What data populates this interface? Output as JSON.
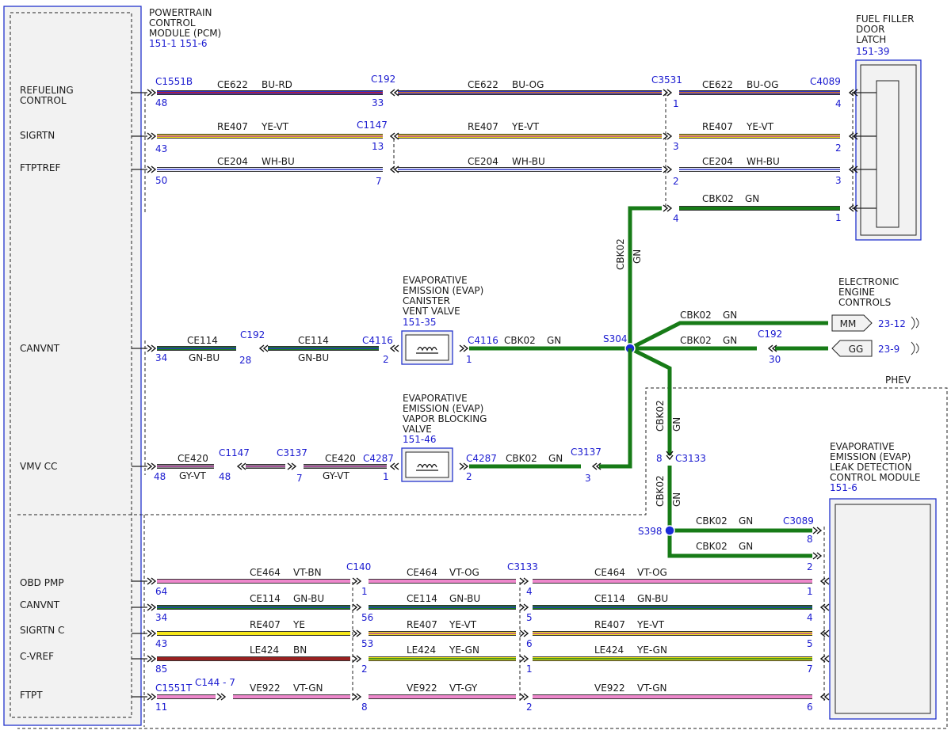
{
  "pcm": {
    "name": [
      "POWERTRAIN",
      "CONTROL",
      "MODULE (PCM)"
    ],
    "ref": "151-1 151-6",
    "pins": [
      "REFUELING",
      "CONTROL",
      "SIGRTN",
      "FTPTREF",
      "CANVNT",
      "VMV CC",
      "OBD PMP",
      "CANVNT",
      "SIGRTN C",
      "C-VREF",
      "FTPT"
    ]
  },
  "latch": {
    "name": [
      "FUEL FILLER",
      "DOOR",
      "LATCH"
    ],
    "ref": "151-39"
  },
  "eec": {
    "name": [
      "ELECTRONIC",
      "ENGINE",
      "CONTROLS"
    ],
    "mm": "MM",
    "gg": "GG",
    "mm_ref": "23-12",
    "gg_ref": "23-9"
  },
  "vent": {
    "name": [
      "EVAPORATIVE",
      "EMISSION (EVAP)",
      "CANISTER",
      "VENT VALVE"
    ],
    "ref": "151-35"
  },
  "vbv": {
    "name": [
      "EVAPORATIVE",
      "EMISSION (EVAP)",
      "VAPOR BLOCKING",
      "VALVE"
    ],
    "ref": "151-46"
  },
  "ldcm": {
    "name": [
      "EVAPORATIVE",
      "EMISSION (EVAP)",
      "LEAK DETECTION",
      "CONTROL MODULE"
    ],
    "ref": "151-6"
  },
  "phev": "PHEV",
  "splices": [
    "S304",
    "S398"
  ],
  "connectors": [
    "C1551B",
    "C192",
    "C3531",
    "C4089",
    "C1147",
    "C192",
    "C4116",
    "C4116",
    "C192",
    "C1147",
    "C3137",
    "C4287",
    "C4287",
    "C3137",
    "C3133",
    "C3089",
    "C140",
    "C3133",
    "C1551T",
    "C144 - 7"
  ],
  "pins": [
    "48",
    "33",
    "1",
    "4",
    "43",
    "13",
    "3",
    "2",
    "50",
    "7",
    "2",
    "3",
    "4",
    "1",
    "34",
    "28",
    "2",
    "1",
    "30",
    "48",
    "48",
    "7",
    "1",
    "2",
    "3",
    "8",
    "8",
    "2",
    "64",
    "1",
    "4",
    "1",
    "34",
    "56",
    "5",
    "4",
    "43",
    "53",
    "6",
    "5",
    "85",
    "2",
    "1",
    "7",
    "11",
    "8",
    "2",
    "6"
  ],
  "wires": [
    [
      "CE622",
      "BU-RD"
    ],
    [
      "CE622",
      "BU-OG"
    ],
    [
      "CE622",
      "BU-OG"
    ],
    [
      "RE407",
      "YE-VT"
    ],
    [
      "RE407",
      "YE-VT"
    ],
    [
      "RE407",
      "YE-VT"
    ],
    [
      "CE204",
      "WH-BU"
    ],
    [
      "CE204",
      "WH-BU"
    ],
    [
      "CE204",
      "WH-BU"
    ],
    [
      "CBK02",
      "GN"
    ],
    [
      "CE114",
      "GN-BU"
    ],
    [
      "CE114",
      "GN-BU"
    ],
    [
      "CBK02",
      "GN"
    ],
    [
      "CBK02",
      "GN"
    ],
    [
      "CBK02",
      "GN"
    ],
    [
      "CE420",
      "GY-VT"
    ],
    [
      "CE420",
      "GY-VT"
    ],
    [
      "CBK02",
      "GN"
    ],
    [
      "CBK02",
      "GN"
    ],
    [
      "CBK02",
      "GN"
    ],
    [
      "CE464",
      "VT-BN"
    ],
    [
      "CE464",
      "VT-OG"
    ],
    [
      "CE464",
      "VT-OG"
    ],
    [
      "CE114",
      "GN-BU"
    ],
    [
      "CE114",
      "GN-BU"
    ],
    [
      "CE114",
      "GN-BU"
    ],
    [
      "RE407",
      "YE"
    ],
    [
      "RE407",
      "YE-VT"
    ],
    [
      "RE407",
      "YE-VT"
    ],
    [
      "LE424",
      "BN"
    ],
    [
      "LE424",
      "YE-GN"
    ],
    [
      "LE424",
      "YE-GN"
    ],
    [
      "VE922",
      "VT-GN"
    ],
    [
      "VE922",
      "VT-GY"
    ],
    [
      "VE922",
      "VT-GN"
    ]
  ],
  "vwires": [
    [
      "CBK02",
      "GN"
    ],
    [
      "CBK02",
      "GN"
    ],
    [
      "CBK02",
      "GN"
    ]
  ],
  "colors": {
    "BU": "#2b33c6",
    "RD": "#d11a1a",
    "OG": "#f07f17",
    "YE": "#f5e61a",
    "VT": "#b040a0",
    "WH": "#ffffff",
    "GN": "#177b17",
    "GY": "#8a8a8a",
    "BN": "#9a2121",
    "PK": "#ee88cc",
    "LABEL_BLUE": "#1a1ad0",
    "BOX_BLUE": "#2233cc"
  }
}
